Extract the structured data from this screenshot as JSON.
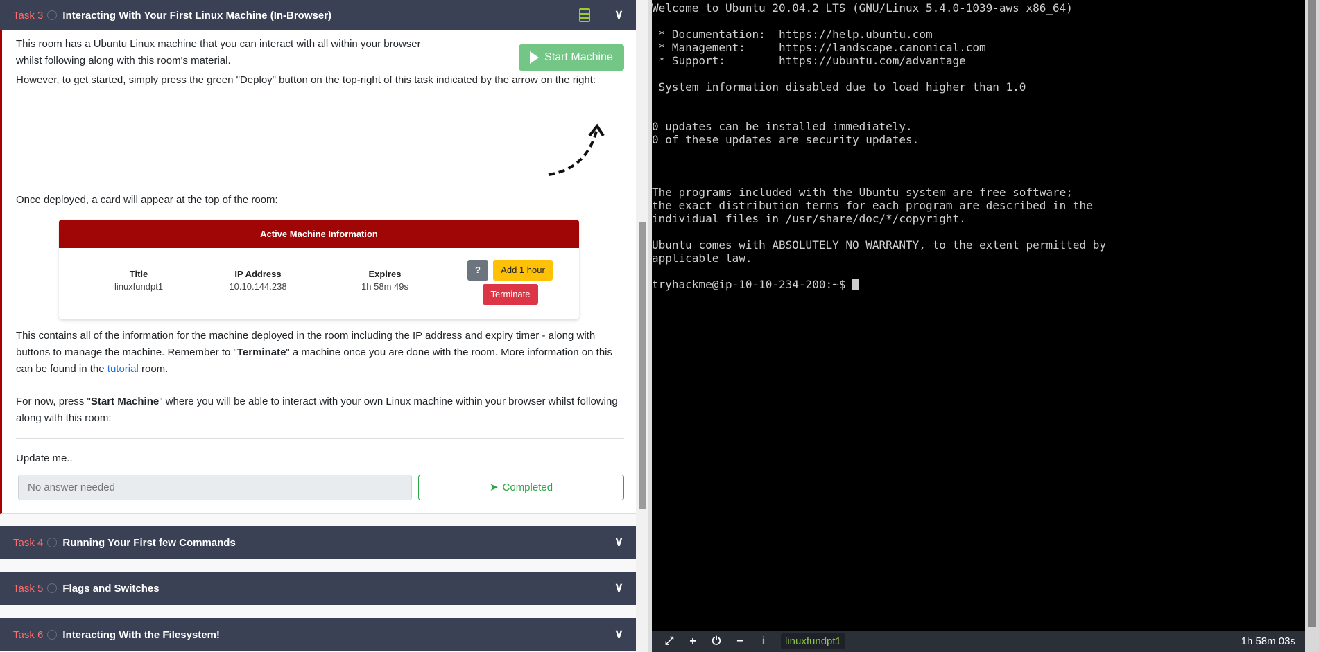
{
  "tasks": [
    {
      "num": "Task 3",
      "title": "Interacting With Your First Linux Machine (In-Browser)"
    },
    {
      "num": "Task 4",
      "title": "Running Your First few Commands"
    },
    {
      "num": "Task 5",
      "title": "Flags and Switches"
    },
    {
      "num": "Task 6",
      "title": "Interacting With the Filesystem!"
    }
  ],
  "task3": {
    "p1": "This room has a Ubuntu Linux machine that you can interact with all within your browser whilst following along with this room's material.",
    "start_label": "Start Machine",
    "p2": "However, to get started, simply press the green \"Deploy\" button on the top-right of this task indicated by the arrow on the right:",
    "p3": "Once deployed, a card will appear at the top of the room:",
    "card": {
      "header": "Active Machine Information",
      "title_label": "Title",
      "title_value": "linuxfundpt1",
      "ip_label": "IP Address",
      "ip_value": "10.10.144.238",
      "expires_label": "Expires",
      "expires_value": "1h 58m 49s",
      "help": "?",
      "add_hour": "Add 1 hour",
      "terminate": "Terminate"
    },
    "p4a": "This contains all of the information for the machine deployed in the room including the IP address and expiry timer - along with buttons to manage the machine. Remember to \"",
    "p4b": "Terminate",
    "p4c": "\" a machine once you are done with the room. More information on this can be found in the ",
    "p4link": "tutorial",
    "p4d": " room.",
    "p5a": "For now, press \"",
    "p5b": "Start Machine",
    "p5c": "\" where you will be able to interact with your own Linux machine within your browser whilst following along with this room:",
    "question": "Update me..",
    "answer_placeholder": "No answer needed",
    "completed": "Completed"
  },
  "terminal": {
    "lines": [
      "Welcome to Ubuntu 20.04.2 LTS (GNU/Linux 5.4.0-1039-aws x86_64)",
      "",
      " * Documentation:  https://help.ubuntu.com",
      " * Management:     https://landscape.canonical.com",
      " * Support:        https://ubuntu.com/advantage",
      "",
      " System information disabled due to load higher than 1.0",
      "",
      "",
      "0 updates can be installed immediately.",
      "0 of these updates are security updates.",
      "",
      "",
      "",
      "The programs included with the Ubuntu system are free software;",
      "the exact distribution terms for each program are described in the",
      "individual files in /usr/share/doc/*/copyright.",
      "",
      "Ubuntu comes with ABSOLUTELY NO WARRANTY, to the extent permitted by",
      "applicable law.",
      ""
    ],
    "prompt": "tryhackme@ip-10-10-234-200:~$ ",
    "machine": "linuxfundpt1",
    "timer": "1h 58m 03s"
  }
}
